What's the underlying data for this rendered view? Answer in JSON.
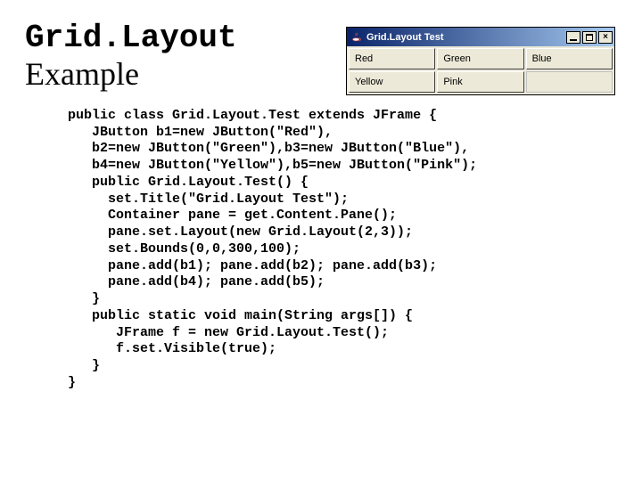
{
  "title": {
    "mono": "Grid.Layout",
    "rest": "Example"
  },
  "window": {
    "title": "Grid.Layout Test",
    "buttons": [
      "Red",
      "Green",
      "Blue",
      "Yellow",
      "Pink",
      ""
    ]
  },
  "code": "public class Grid.Layout.Test extends JFrame {\n   JButton b1=new JButton(\"Red\"),\n   b2=new JButton(\"Green\"),b3=new JButton(\"Blue\"),\n   b4=new JButton(\"Yellow\"),b5=new JButton(\"Pink\");\n   public Grid.Layout.Test() {\n     set.Title(\"Grid.Layout Test\");\n     Container pane = get.Content.Pane();\n     pane.set.Layout(new Grid.Layout(2,3));\n     set.Bounds(0,0,300,100);\n     pane.add(b1); pane.add(b2); pane.add(b3);\n     pane.add(b4); pane.add(b5);\n   }\n   public static void main(String args[]) {\n      JFrame f = new Grid.Layout.Test();\n      f.set.Visible(true);\n   }\n}"
}
